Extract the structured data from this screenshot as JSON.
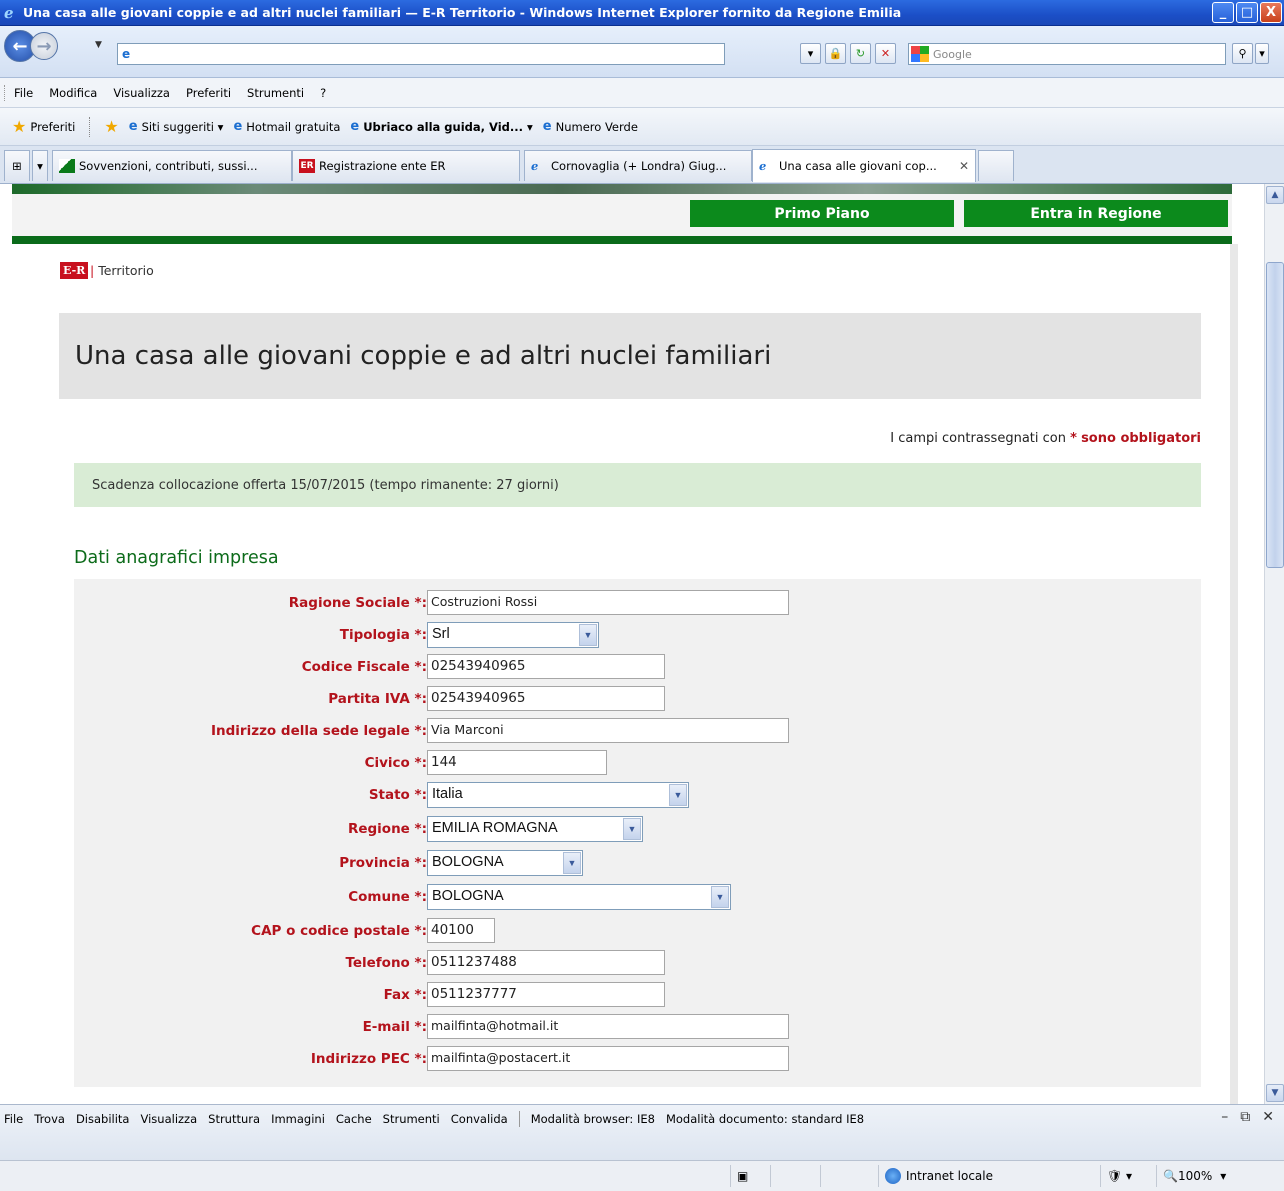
{
  "window": {
    "title": "Una casa alle giovani coppie e ad altri nuclei familiari — E-R Territorio - Windows Internet Explorer fornito da Regione Emilia",
    "minimize": "_",
    "maximize": "□",
    "close": "X"
  },
  "address": {
    "url": ""
  },
  "search": {
    "placeholder": "Google"
  },
  "menu": [
    "File",
    "Modifica",
    "Visualizza",
    "Preferiti",
    "Strumenti",
    "?"
  ],
  "favorites": {
    "label": "Preferiti",
    "items": [
      "Siti suggeriti ▾",
      "Hotmail gratuita",
      "Ubriaco alla guida, Vid... ▾",
      "Numero Verde"
    ]
  },
  "tabs": [
    {
      "label": "Sovvenzioni, contributi, sussi..."
    },
    {
      "label": "Registrazione ente ER"
    },
    {
      "label": "Cornovaglia (+ Londra) Giug..."
    },
    {
      "label": "Una casa alle giovani cop..."
    }
  ],
  "site": {
    "nav": [
      "Primo Piano",
      "Entra in Regione"
    ],
    "logo": "E-R",
    "section_name": "Territorio",
    "page_title": "Una casa alle giovani coppie e ad altri nuclei familiari",
    "required_prefix": "I campi contrassegnati con",
    "required_star": "*",
    "required_suffix": "sono obbligatori",
    "deadline": "Scadenza collocazione offerta 15/07/2015 (tempo rimanente: 27 giorni)",
    "section_heading": "Dati anagrafici impresa"
  },
  "form": {
    "fields": [
      {
        "label": "Ragione Sociale *:",
        "value": "Costruzioni Rossi",
        "kind": "input"
      },
      {
        "label": "Tipologia *:",
        "value": "Srl",
        "kind": "select"
      },
      {
        "label": "Codice Fiscale *:",
        "value": "02543940965",
        "kind": "input"
      },
      {
        "label": "Partita IVA *:",
        "value": "02543940965",
        "kind": "input"
      },
      {
        "label": "Indirizzo della sede legale *:",
        "value": "Via Marconi",
        "kind": "input"
      },
      {
        "label": "Civico *:",
        "value": "144",
        "kind": "input"
      },
      {
        "label": "Stato *:",
        "value": "Italia",
        "kind": "select"
      },
      {
        "label": "Regione *:",
        "value": "EMILIA ROMAGNA",
        "kind": "select"
      },
      {
        "label": "Provincia *:",
        "value": "BOLOGNA",
        "kind": "select"
      },
      {
        "label": "Comune *:",
        "value": "BOLOGNA",
        "kind": "select"
      },
      {
        "label": "CAP o codice postale *:",
        "value": "40100",
        "kind": "input"
      },
      {
        "label": "Telefono *:",
        "value": "0511237488",
        "kind": "input"
      },
      {
        "label": "Fax *:",
        "value": "0511237777",
        "kind": "input"
      },
      {
        "label": "E-mail *:",
        "value": "mailfinta@hotmail.it",
        "kind": "input"
      },
      {
        "label": "Indirizzo PEC *:",
        "value": "mailfinta@postacert.it",
        "kind": "input"
      }
    ]
  },
  "devtools": {
    "menu": [
      "File",
      "Trova",
      "Disabilita",
      "Visualizza",
      "Struttura",
      "Immagini",
      "Cache",
      "Strumenti",
      "Convalida"
    ],
    "browser_mode": "Modalità browser: IE8",
    "document_mode": "Modalità documento: standard IE8"
  },
  "status": {
    "zone": "Intranet locale",
    "zoom": "100%"
  }
}
